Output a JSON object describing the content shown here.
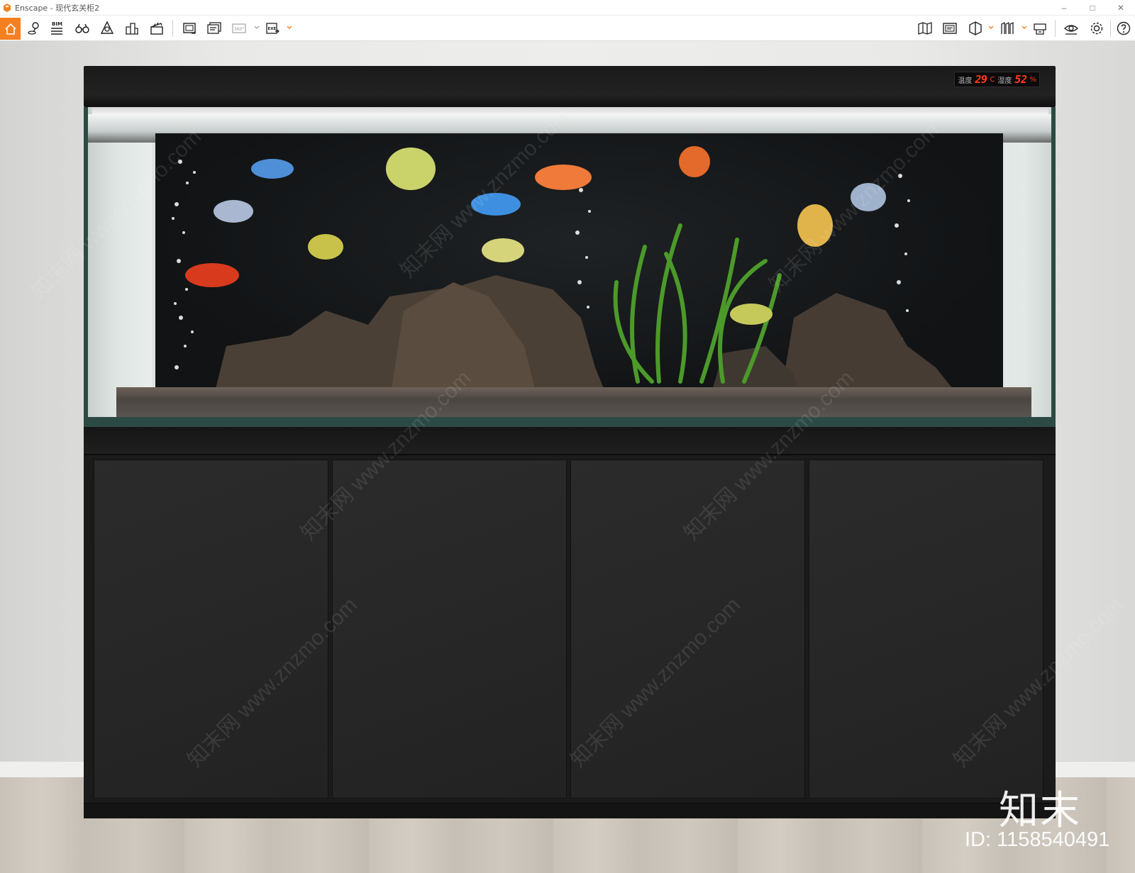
{
  "window": {
    "app_name": "Enscape",
    "title": "Enscape - 现代玄关柜2",
    "controls": [
      "minimize-icon",
      "maximize-icon",
      "close-icon"
    ]
  },
  "toolbar": {
    "left_icons": [
      "home-icon",
      "location-pin-icon",
      "bim-icon",
      "binoculars-icon",
      "asset-library-icon",
      "buildings-icon",
      "clapperboard-icon",
      "screenshot-icon",
      "batch-render-icon",
      "panorama-360-icon",
      "exe-export-icon"
    ],
    "bim_label": "BIM",
    "panorama_label": "360°",
    "exe_label": "EXE",
    "right_icons": [
      "map-icon",
      "minimap-icon",
      "section-icon",
      "views-icon",
      "object-icon",
      "visual-settings-icon",
      "settings-icon",
      "help-icon"
    ],
    "accent_color": "#f48020"
  },
  "scene": {
    "display": {
      "temp_label": "温度",
      "temp_value": "29",
      "temp_unit": "C",
      "humidity_label": "湿度",
      "humidity_value": "52",
      "humidity_unit": "%"
    },
    "watermark": {
      "brand": "知末",
      "id_text": "ID: 1158540491",
      "diagonal": "知末网 www.znzmo.com"
    }
  }
}
